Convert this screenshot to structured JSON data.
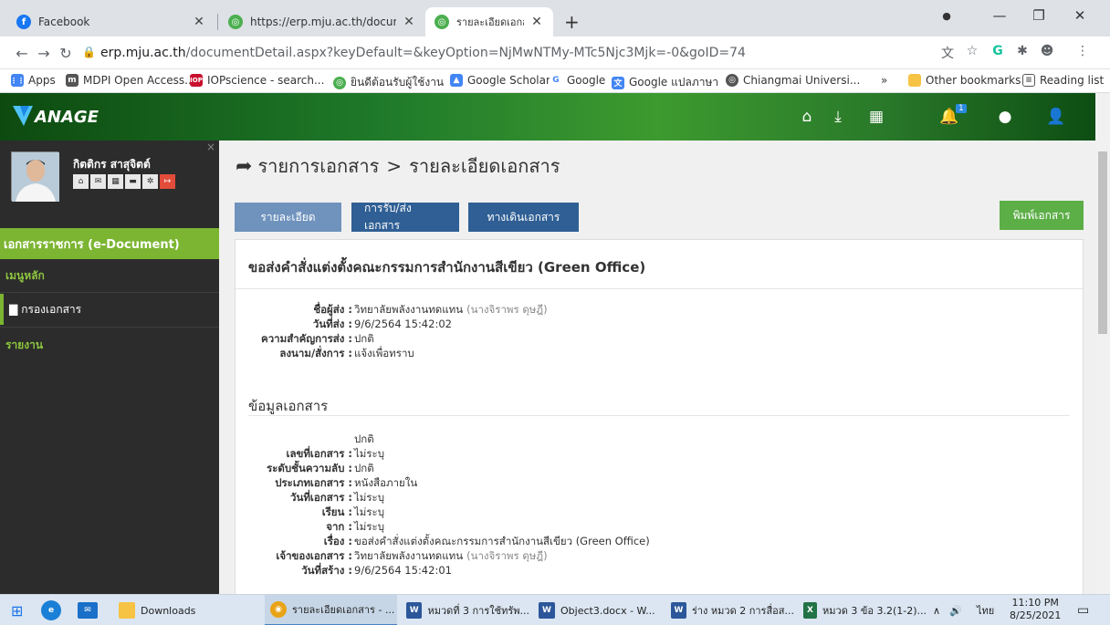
{
  "browser": {
    "tabs": [
      {
        "title": "Facebook",
        "icon": "facebook-icon",
        "active": false
      },
      {
        "title": "https://erp.mju.ac.th/documentF",
        "icon": "globe-icon",
        "active": false
      },
      {
        "title": "รายละเอียดเอกสาร",
        "icon": "globe-icon",
        "active": true
      }
    ],
    "url_host": "erp.mju.ac.th",
    "url_path": "/documentDetail.aspx?keyDefault=&keyOption=NjMwNTMy-MTc5Njc3Mjk=-0&goID=74",
    "bookmarks": [
      "Apps",
      "MDPI Open Access...",
      "IOPscience - search...",
      "ยินดีต้อนรับผู้ใช้งาน",
      "Google Scholar",
      "Google",
      "Google แปลภาษา",
      "Chiangmai Universi..."
    ],
    "bookmarks_overflow": "»",
    "other_bookmarks": "Other bookmarks",
    "reading_list": "Reading list"
  },
  "app": {
    "logo_text": "ANAGE",
    "notification_count": "1"
  },
  "sidebar": {
    "user_name": "กิตติกร สาสุจิตต์",
    "section_title": "เอกสารราชการ (e-Document)",
    "main_menu": "เมนูหลัก",
    "doc_filter": "กรองเอกสาร",
    "report": "รายงาน"
  },
  "main": {
    "breadcrumb_root": "รายการเอกสาร",
    "breadcrumb_sep": ">",
    "breadcrumb_current": "รายละเอียดเอกสาร",
    "tabs": [
      "รายละเอียด",
      "การรับ/ส่งเอกสาร",
      "ทางเดินเอกสาร"
    ],
    "print_label": "พิมพ์เอกสาร",
    "panel_title": "ขอส่งคำสั่งแต่งตั้งคณะกรรมการสำนักงานสีเขียว (Green Office)",
    "send_info": [
      {
        "key": "ชื่อผู้ส่ง :",
        "value": "วิทยาลัยพลังงานทดแทน",
        "extra": "(นางจิราพร ดุษฎี)"
      },
      {
        "key": "วันที่ส่ง :",
        "value": "9/6/2564 15:42:02",
        "extra": ""
      },
      {
        "key": "ความสำคัญการส่ง :",
        "value": "ปกติ",
        "extra": ""
      },
      {
        "key": "ลงนาม/สั่งการ :",
        "value": "แจ้งเพื่อทราบ",
        "extra": ""
      }
    ],
    "section_title": "ข้อมูลเอกสาร",
    "doc_status": "ปกติ",
    "doc_info": [
      {
        "key": "เลขที่เอกสาร :",
        "value": "ไม่ระบุ",
        "extra": ""
      },
      {
        "key": "ระดับชั้นความลับ :",
        "value": "ปกติ",
        "extra": ""
      },
      {
        "key": "ประเภทเอกสาร :",
        "value": "หนังสือภายใน",
        "extra": ""
      },
      {
        "key": "วันที่เอกสาร :",
        "value": "ไม่ระบุ",
        "extra": ""
      },
      {
        "key": "เรียน :",
        "value": "ไม่ระบุ",
        "extra": ""
      },
      {
        "key": "จาก :",
        "value": "ไม่ระบุ",
        "extra": ""
      },
      {
        "key": "เรื่อง :",
        "value": "ขอส่งคำสั่งแต่งตั้งคณะกรรมการสำนักงานสีเขียว (Green Office)",
        "extra": ""
      },
      {
        "key": "เจ้าของเอกสาร :",
        "value": "วิทยาลัยพลังงานทดแทน",
        "extra": "(นางจิราพร ดุษฎี)"
      },
      {
        "key": "วันที่สร้าง :",
        "value": "9/6/2564 15:42:01",
        "extra": ""
      }
    ]
  },
  "taskbar": {
    "items": [
      {
        "label": "Downloads",
        "icon": "folder-icon"
      },
      {
        "label": "รายละเอียดเอกสาร - ...",
        "icon": "chrome-icon"
      },
      {
        "label": "หมวดที่ 3 การใช้ทรัพ...",
        "icon": "word-icon"
      },
      {
        "label": "Object3.docx - W...",
        "icon": "word-icon"
      },
      {
        "label": "ร่าง หมวด 2 การสื่อส...",
        "icon": "word-icon"
      },
      {
        "label": "หมวด 3 ข้อ 3.2(1-2)...",
        "icon": "excel-icon"
      }
    ],
    "lang": "ไทย",
    "time": "11:10 PM",
    "date": "8/25/2021"
  }
}
